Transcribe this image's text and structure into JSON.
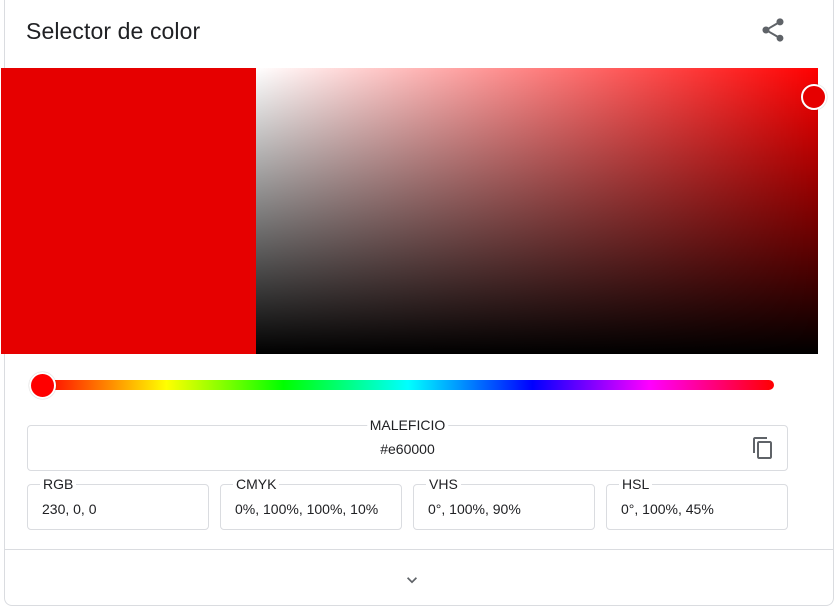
{
  "header": {
    "title": "Selector de color",
    "share_icon": "share-icon"
  },
  "picker": {
    "selected_color": "#e60000",
    "hue_color": "#ff0000",
    "hue_degrees": 0,
    "saturation_percent": 100,
    "value_percent": 90
  },
  "hex": {
    "label": "MALEFICIO",
    "value": "#e60000",
    "copy_icon": "copy-icon"
  },
  "formats": [
    {
      "label": "RGB",
      "value": "230, 0, 0"
    },
    {
      "label": "CMYK",
      "value": "0%, 100%, 100%, 10%"
    },
    {
      "label": "VHS",
      "value": "0°, 100%, 90%"
    },
    {
      "label": "HSL",
      "value": "0°, 100%, 45%"
    }
  ],
  "footer": {
    "expand_icon": "chevron-down-icon"
  }
}
